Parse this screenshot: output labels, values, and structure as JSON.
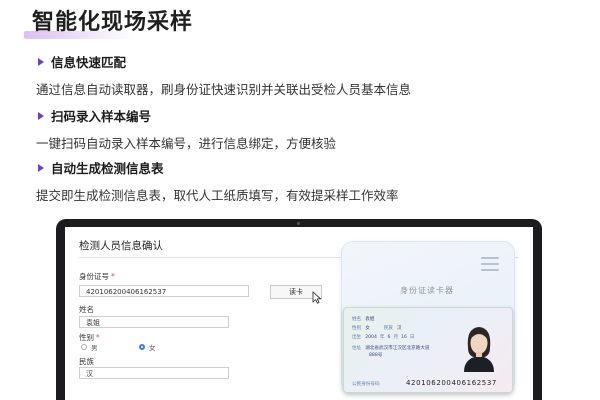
{
  "header": {
    "title": "智能化现场采样"
  },
  "features": [
    {
      "title": "信息快速匹配",
      "desc": "通过信息自动读取器，刷身份证快速识别并关联出受检人员基本信息"
    },
    {
      "title": "扫码录入样本编号",
      "desc": "一键扫码自动录入样本编号，进行信息绑定，方便核验"
    },
    {
      "title": "自动生成检测信息表",
      "desc": "提交即生成检测信息表，取代人工纸质填写，有效提采样工作效率"
    }
  ],
  "form": {
    "title": "检测人员信息确认",
    "id_label": "身份证号",
    "id_value": "420106200406162537",
    "read_button": "读卡",
    "name_label": "姓名",
    "name_value": "袁姐",
    "gender_label": "性别",
    "gender_options": [
      "男",
      "女"
    ],
    "gender_selected": "女",
    "ethnicity_label": "民族",
    "ethnicity_value": "汉"
  },
  "reader": {
    "label": "身份证读卡器"
  },
  "idcard": {
    "name_key": "姓名",
    "name": "袁姐",
    "gender_key": "性别",
    "gender": "女",
    "ethnicity_key": "民族",
    "ethnicity": "汉",
    "birth_key": "出生",
    "birth_year": "2004",
    "birth_month": "6",
    "birth_day": "16",
    "address_key": "住址",
    "address": "湖北省武汉市江汉区北京路大道",
    "address_line2": "888号",
    "number_key": "公民身份号码",
    "number": "420106200406162537"
  },
  "colors": {
    "accent": "#6a3fd4",
    "required": "#e84a4a",
    "radio_selected": "#3b7ddd"
  }
}
